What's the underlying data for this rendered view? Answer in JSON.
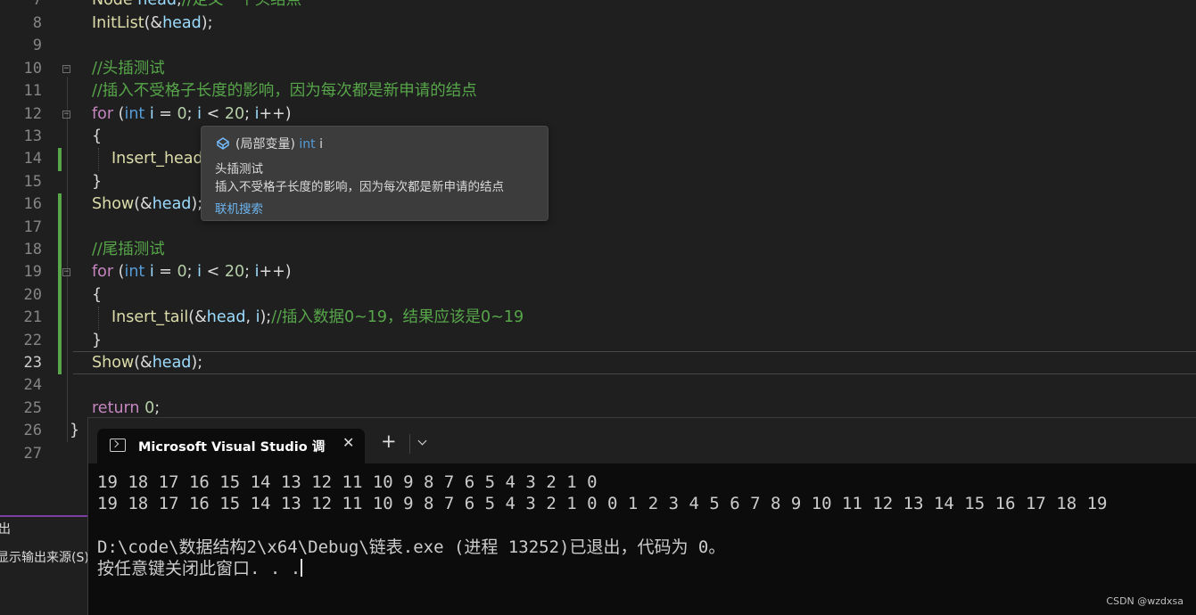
{
  "editor": {
    "lines": [
      {
        "n": "7",
        "code": "Node head;//定义一个头结点"
      },
      {
        "n": "8",
        "code": "InitList(&head);"
      },
      {
        "n": "9",
        "code": ""
      },
      {
        "n": "10",
        "code": "//头插测试"
      },
      {
        "n": "11",
        "code": "//插入不受格子长度的影响，因为每次都是新申请的结点"
      },
      {
        "n": "12",
        "code": "for (int i = 0; i < 20; i++)"
      },
      {
        "n": "13",
        "code": "{"
      },
      {
        "n": "14",
        "code": "Insert_head"
      },
      {
        "n": "15",
        "code": "}"
      },
      {
        "n": "16",
        "code": "Show(&head);"
      },
      {
        "n": "17",
        "code": ""
      },
      {
        "n": "18",
        "code": "//尾插测试"
      },
      {
        "n": "19",
        "code": "for (int i = 0; i < 20; i++)"
      },
      {
        "n": "20",
        "code": "{"
      },
      {
        "n": "21",
        "code": "Insert_tail(&head, i);//插入数据0~19，结果应该是0~19"
      },
      {
        "n": "22",
        "code": "}"
      },
      {
        "n": "23",
        "code": "Show(&head);"
      },
      {
        "n": "24",
        "code": ""
      },
      {
        "n": "25",
        "code": "return 0;"
      },
      {
        "n": "26",
        "code": "}"
      },
      {
        "n": "27",
        "code": ""
      }
    ]
  },
  "tooltip": {
    "scope": "(局部变量)",
    "type": "int",
    "name": "i",
    "comment_line1": "头插测试",
    "comment_line2": "插入不受格子长度的影响，因为每次都是新申请的结点",
    "link": "联机搜索"
  },
  "output_panel": {
    "title": "出",
    "source_label": "显示输出来源(S):"
  },
  "terminal": {
    "tab_title": "Microsoft Visual Studio 调试控制台",
    "close_glyph": "✕",
    "add_glyph": "+",
    "lines": [
      "19 18 17 16 15 14 13 12 11 10 9 8 7 6 5 4 3 2 1 0",
      "19 18 17 16 15 14 13 12 11 10 9 8 7 6 5 4 3 2 1 0 0 1 2 3 4 5 6 7 8 9 10 11 12 13 14 15 16 17 18 19",
      "",
      "D:\\code\\数据结构2\\x64\\Debug\\链表.exe (进程 13252)已退出，代码为 0。",
      "按任意键关闭此窗口. . ."
    ]
  },
  "watermark": "CSDN @wzdxsa",
  "colors": {
    "keyword": "#c586c0",
    "type": "#569cd6",
    "function": "#dcdcaa",
    "variable": "#9cdcfe",
    "number": "#b5cea8",
    "comment": "#57a64a",
    "change_bar": "#57a64a",
    "panel_accent": "#7b3fa4"
  },
  "icons": {
    "tooltip": "local-variable-icon",
    "terminal_tab": "console-icon",
    "dropdown": "chevron-down-icon"
  }
}
